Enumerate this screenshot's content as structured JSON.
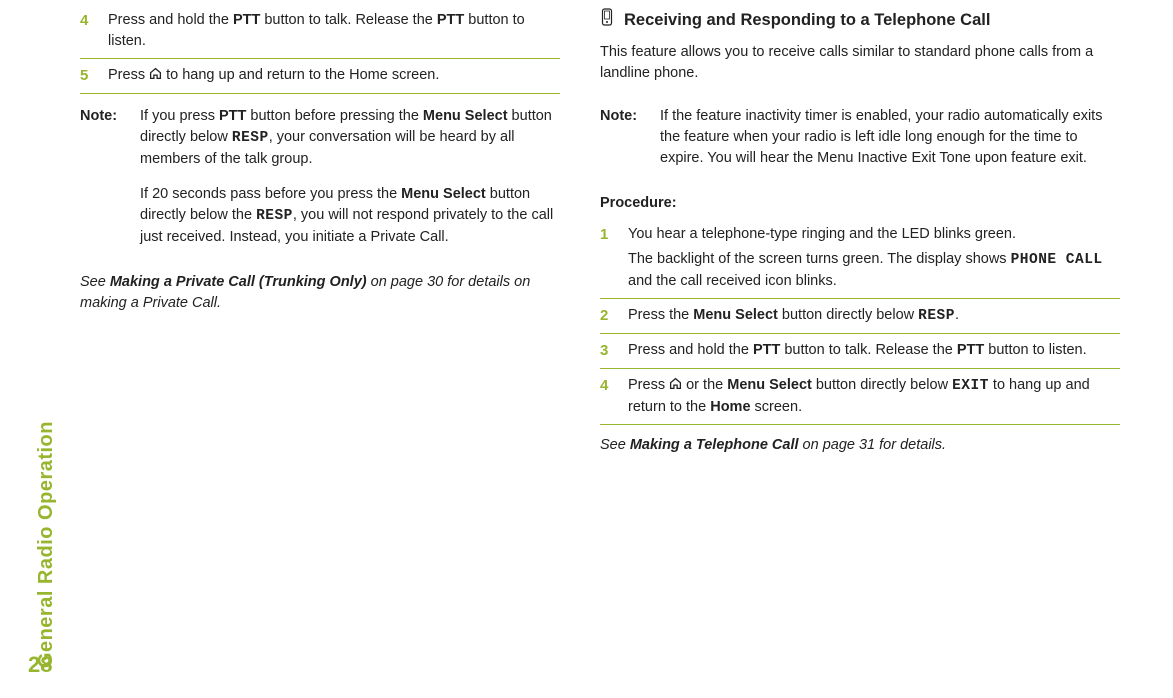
{
  "sidebar": {
    "title": "General Radio Operation"
  },
  "page_number": "28",
  "left": {
    "step4_num": "4",
    "step4_a": "Press and hold the ",
    "step4_b": "PTT",
    "step4_c": " button to talk. Release the ",
    "step4_d": "PTT",
    "step4_e": " button to listen.",
    "step5_num": "5",
    "step5_a": "Press ",
    "step5_b": " to hang up and return to the Home screen.",
    "note_label": "Note:",
    "note_p1_a": "If you press ",
    "note_p1_b": "PTT",
    "note_p1_c": " button before pressing the ",
    "note_p1_d": "Menu Select",
    "note_p1_e": " button directly below ",
    "note_p1_f": "RESP",
    "note_p1_g": ", your conversation will be heard by all members of the talk group.",
    "note_p2_a": "If 20 seconds pass before you press the ",
    "note_p2_b": "Menu Select",
    "note_p2_c": " button directly below the ",
    "note_p2_d": "RESP",
    "note_p2_e": ", you will not respond privately to the call just received. Instead, you initiate a Private Call.",
    "see_a": "See ",
    "see_b": "Making a Private Call (Trunking Only)",
    "see_c": " on page 30 for details on making a Private Call."
  },
  "right": {
    "heading": "Receiving and Responding to a Telephone Call",
    "intro": "This feature allows you to receive calls similar to standard phone calls from a landline phone.",
    "note_label": "Note:",
    "note_body": "If the feature inactivity timer is enabled, your radio automatically exits the feature when your radio is left idle long enough for the time to expire. You will hear the Menu Inactive Exit Tone upon feature exit.",
    "procedure_label": "Procedure:",
    "s1_num": "1",
    "s1_a": "You hear a telephone-type ringing and the LED blinks green.",
    "s1_b_a": "The backlight of the screen turns green. The display shows ",
    "s1_b_b": "PHONE CALL",
    "s1_b_c": " and the call received icon blinks.",
    "s2_num": "2",
    "s2_a": "Press the ",
    "s2_b": "Menu Select",
    "s2_c": " button directly below ",
    "s2_d": "RESP",
    "s2_e": ".",
    "s3_num": "3",
    "s3_a": "Press and hold the ",
    "s3_b": "PTT",
    "s3_c": " button to talk. Release the ",
    "s3_d": "PTT",
    "s3_e": " button to listen.",
    "s4_num": "4",
    "s4_a": "Press ",
    "s4_b": " or the ",
    "s4_c": "Menu Select",
    "s4_d": " button directly below ",
    "s4_e": "EXIT",
    "s4_f": " to hang up and return to the ",
    "s4_g": "Home",
    "s4_h": " screen.",
    "see_a": "See ",
    "see_b": "Making a Telephone Call",
    "see_c": " on page 31 for details."
  }
}
